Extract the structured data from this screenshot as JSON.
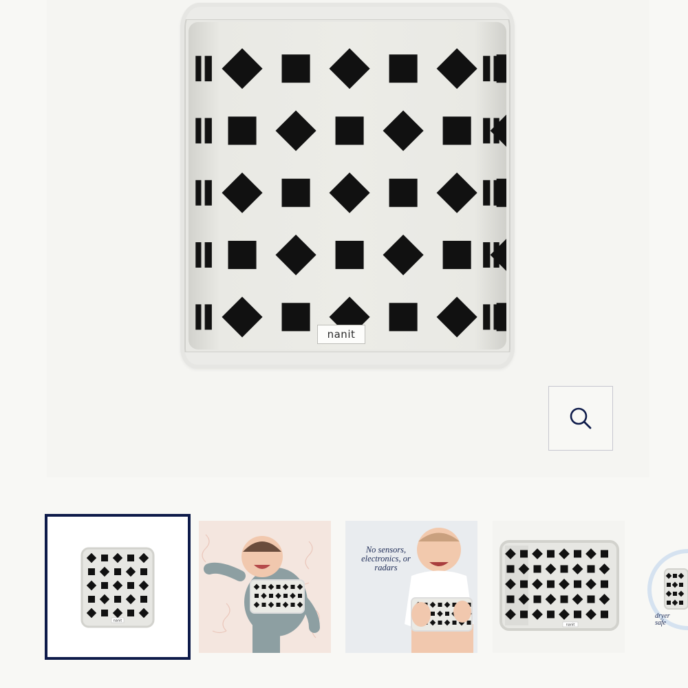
{
  "product": {
    "brand_label": "nanit",
    "zoom_icon": "search-icon"
  },
  "gallery": {
    "selected_index": 0,
    "thumbnails": [
      {
        "name": "breathing-band-front"
      },
      {
        "name": "baby-wearing-band"
      },
      {
        "name": "baby-band-feature",
        "caption": "No sensors, electronics, or radars"
      },
      {
        "name": "breathing-band-flat"
      },
      {
        "name": "dryer-safe",
        "caption": "dryer safe"
      }
    ]
  },
  "colors": {
    "background": "#f8f8f5",
    "accent_navy": "#0e1b4a",
    "band_fabric": "#e8e8e4",
    "pattern": "#111111"
  }
}
